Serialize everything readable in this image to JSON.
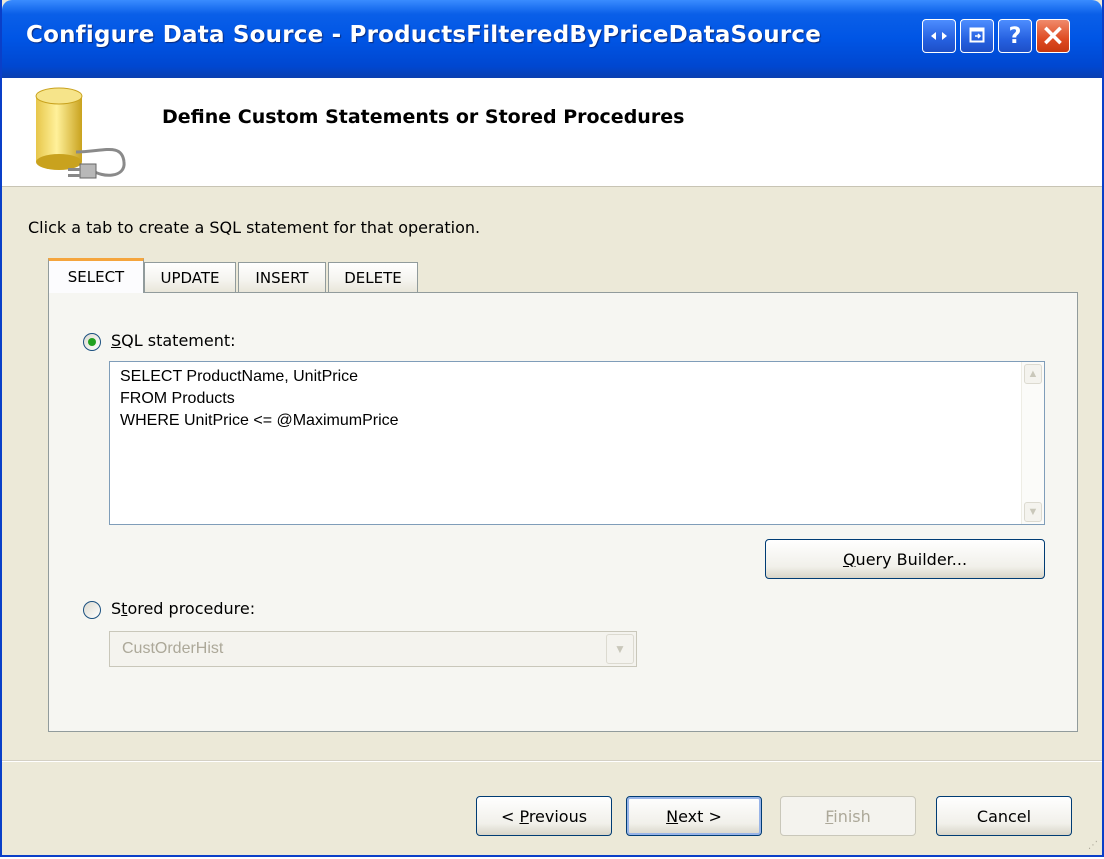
{
  "window": {
    "title": "Configure Data Source - ProductsFilteredByPriceDataSource",
    "buttons": {
      "restore": "restore-icon",
      "help": "?",
      "close": "×"
    }
  },
  "header": {
    "title": "Define Custom Statements or Stored Procedures",
    "icon": "database-plug-icon"
  },
  "instruction": "Click a tab to create a SQL statement for that operation.",
  "tabs": [
    {
      "label": "SELECT",
      "active": true
    },
    {
      "label": "UPDATE",
      "active": false
    },
    {
      "label": "INSERT",
      "active": false
    },
    {
      "label": "DELETE",
      "active": false
    }
  ],
  "sql_option": {
    "label_mnemonic": "S",
    "label_rest": "QL statement:",
    "selected": true,
    "lines": [
      "SELECT ProductName, UnitPrice",
      "FROM Products",
      "WHERE UnitPrice <= @MaximumPrice"
    ]
  },
  "query_builder": {
    "mnemonic": "Q",
    "rest": "uery Builder..."
  },
  "stored_option": {
    "label_pre": "S",
    "label_mnemonic": "t",
    "label_rest": "ored procedure:",
    "selected": false,
    "value": "CustOrderHist",
    "enabled": false
  },
  "footer": {
    "previous": {
      "pre": "< ",
      "mnemonic": "P",
      "rest": "revious"
    },
    "next": {
      "mnemonic": "N",
      "rest": "ext >"
    },
    "finish": {
      "mnemonic": "F",
      "rest": "inish",
      "enabled": false
    },
    "cancel": "Cancel"
  },
  "colors": {
    "titlebar": "#0055e5",
    "dialog_bg": "#ece9d8",
    "active_tab_accent": "#f5a53d",
    "radio_dot": "#21a121"
  }
}
